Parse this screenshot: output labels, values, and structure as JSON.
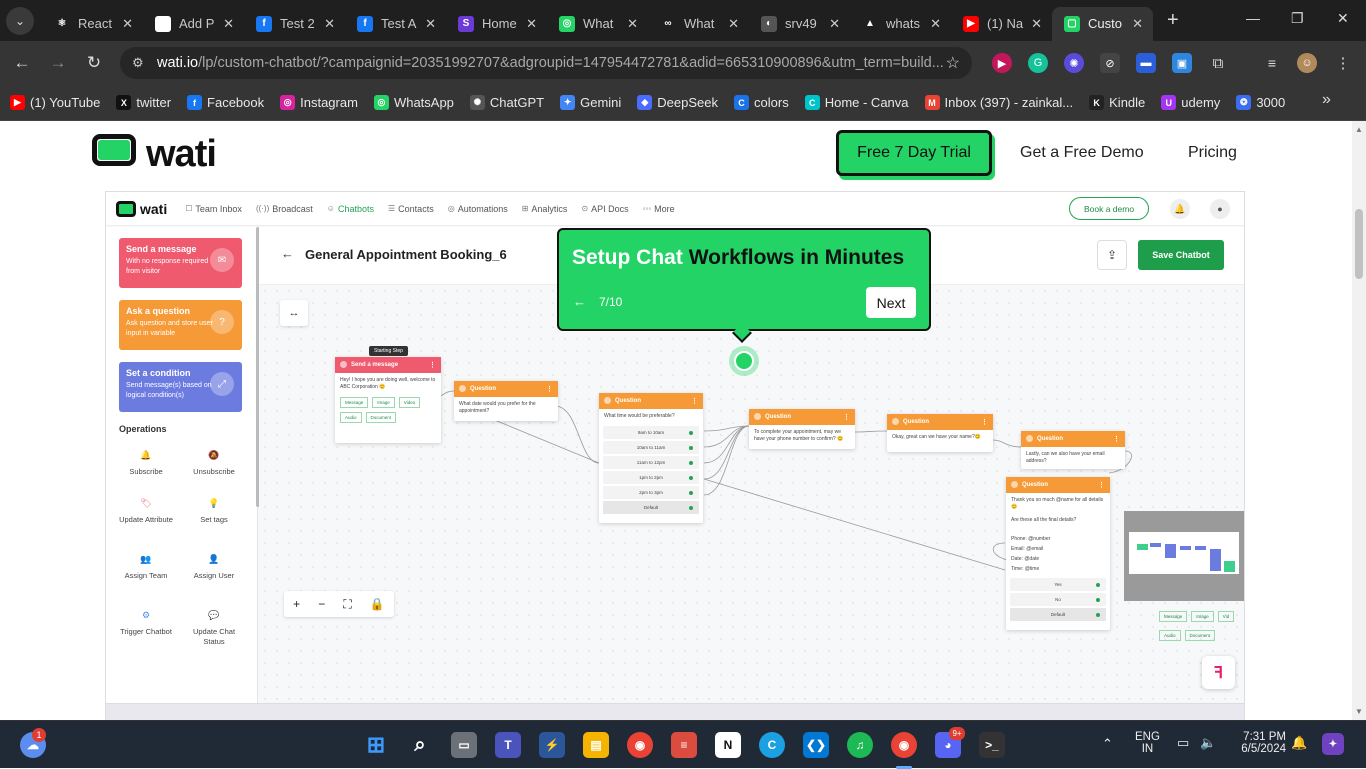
{
  "browser": {
    "tabs": [
      {
        "title": "React",
        "color": "#1f1f1f",
        "glyph": "⚛",
        "active": false
      },
      {
        "title": "Add P",
        "color": "#ffffff",
        "glyph": "▣",
        "active": false
      },
      {
        "title": "Test 2",
        "color": "#1877f2",
        "glyph": "f",
        "active": false
      },
      {
        "title": "Test A",
        "color": "#1877f2",
        "glyph": "f",
        "active": false
      },
      {
        "title": "Home",
        "color": "#6c3ad6",
        "glyph": "S",
        "active": false
      },
      {
        "title": "What",
        "color": "#25d366",
        "glyph": "◎",
        "active": false
      },
      {
        "title": "What",
        "color": "#1f1f1f",
        "glyph": "∞",
        "active": false
      },
      {
        "title": "srv49",
        "color": "#555",
        "glyph": "◐",
        "active": false
      },
      {
        "title": "whats",
        "color": "#1f1f1f",
        "glyph": "▲",
        "active": false
      },
      {
        "title": "(1) Na",
        "color": "#ff0000",
        "glyph": "▶",
        "active": false
      },
      {
        "title": "Custo",
        "color": "#23d366",
        "glyph": "▢",
        "active": true
      }
    ],
    "url_domain": "wati.io",
    "url_rest": "/lp/custom-chatbot/?campaignid=20351992707&adgroupid=147954472781&adid=665310900896&utm_term=build...",
    "bookmarks": [
      {
        "label": "(1) YouTube",
        "color": "#ff0000",
        "glyph": "▶"
      },
      {
        "label": "twitter",
        "color": "#111",
        "glyph": "X"
      },
      {
        "label": "Facebook",
        "color": "#1877f2",
        "glyph": "f"
      },
      {
        "label": "Instagram",
        "color": "#d6249f",
        "glyph": "◎"
      },
      {
        "label": "WhatsApp",
        "color": "#25d366",
        "glyph": "◎"
      },
      {
        "label": "ChatGPT",
        "color": "#555",
        "glyph": "✺"
      },
      {
        "label": "Gemini",
        "color": "#4285f4",
        "glyph": "✦"
      },
      {
        "label": "DeepSeek",
        "color": "#4d6bfe",
        "glyph": "◆"
      },
      {
        "label": "colors",
        "color": "#1a73e8",
        "glyph": "C"
      },
      {
        "label": "Home - Canva",
        "color": "#00c4cc",
        "glyph": "C"
      },
      {
        "label": "Inbox (397) - zainkal...",
        "color": "#ea4335",
        "glyph": "M"
      },
      {
        "label": "Kindle",
        "color": "#222",
        "glyph": "K"
      },
      {
        "label": "udemy",
        "color": "#a435f0",
        "glyph": "U"
      },
      {
        "label": "3000",
        "color": "#3a6df0",
        "glyph": "❂"
      }
    ]
  },
  "site": {
    "logo": "wati",
    "nav": {
      "trial": "Free 7 Day Trial",
      "demo": "Get a Free Demo",
      "pricing": "Pricing"
    },
    "accent": "#23d366"
  },
  "app": {
    "logo": "wati",
    "nav": [
      {
        "label": "Team Inbox",
        "icon": "☐"
      },
      {
        "label": "Broadcast",
        "icon": "((·))"
      },
      {
        "label": "Chatbots",
        "icon": "☺"
      },
      {
        "label": "Contacts",
        "icon": "☰"
      },
      {
        "label": "Automations",
        "icon": "◎"
      },
      {
        "label": "Analytics",
        "icon": "⊞"
      },
      {
        "label": "API Docs",
        "icon": "⊙"
      },
      {
        "label": "More",
        "icon": "◦◦◦"
      }
    ],
    "book_demo": "Book a demo",
    "sidebar": {
      "cards": [
        {
          "title": "Send a message",
          "desc": "With no response required from visitor",
          "color": "#ef5a6e"
        },
        {
          "title": "Ask a question",
          "desc": "Ask question and store user input in variable",
          "color": "#f59a36"
        },
        {
          "title": "Set a condition",
          "desc": "Send message(s) based on logical condition(s)",
          "color": "#6c7be0"
        }
      ],
      "operations_title": "Operations",
      "operations": [
        {
          "label": "Subscribe",
          "color": "#f59a36"
        },
        {
          "label": "Unsubscribe",
          "color": "#f59a36"
        },
        {
          "label": "Update Attribute",
          "color": "#ef5a6e"
        },
        {
          "label": "Set tags",
          "color": "#f5c518"
        },
        {
          "label": "Assign Team",
          "color": "#6c7be0"
        },
        {
          "label": "Assign User",
          "color": "#23a455"
        },
        {
          "label": "Trigger Chatbot",
          "color": "#4a90e2"
        },
        {
          "label": "Update Chat Status",
          "color": "#ef5a6e"
        }
      ]
    },
    "flow_title": "General Appointment Booking_6",
    "save_label": "Save Chatbot",
    "nodes": {
      "start_label": "Starting Step",
      "send_message": {
        "title": "Send a message",
        "text": "Hey! I hope you are doing well, welcome to ABC Corporation 😊",
        "buttons": [
          "Message",
          "Image",
          "Video",
          "Audio",
          "Document"
        ]
      },
      "q1": {
        "title": "Question",
        "text": "What date would you prefer for the appointment?"
      },
      "q2": {
        "title": "Question",
        "text": "What time would be preferable?",
        "options": [
          "9am to 10am",
          "10am to 11am",
          "11am to 12pm",
          "1pm to 2pm",
          "2pm to 3pm",
          "Default"
        ]
      },
      "q3": {
        "title": "Question",
        "text": "To complete your appointment, may we have your phone number to confirm? 😊"
      },
      "q4": {
        "title": "Question",
        "text": "Okay, great can we have your name?😊"
      },
      "q5": {
        "title": "Question",
        "text": "Lastly, can we also have your email address?"
      },
      "q6": {
        "title": "Question",
        "text": "Thank you so much @name for all details 😊",
        "text2": "Are these all the final details?",
        "details": [
          "Phone: @number",
          "Email: @email",
          "Date: @date",
          "Time: @time"
        ],
        "options": [
          "Yes",
          "No",
          "Default"
        ]
      },
      "mini_buttons": [
        "Message",
        "Image",
        "Vid",
        "Audio",
        "Document"
      ]
    },
    "tour": {
      "title_white": "Setup Chat",
      "title_dark": "Workflows in Minutes",
      "step": "7/10",
      "next": "Next"
    }
  },
  "taskbar": {
    "lang": "ENG",
    "region": "IN",
    "time": "7:31 PM",
    "date": "6/5/2024",
    "notif_badge": "1",
    "discord_badge": "9+"
  }
}
